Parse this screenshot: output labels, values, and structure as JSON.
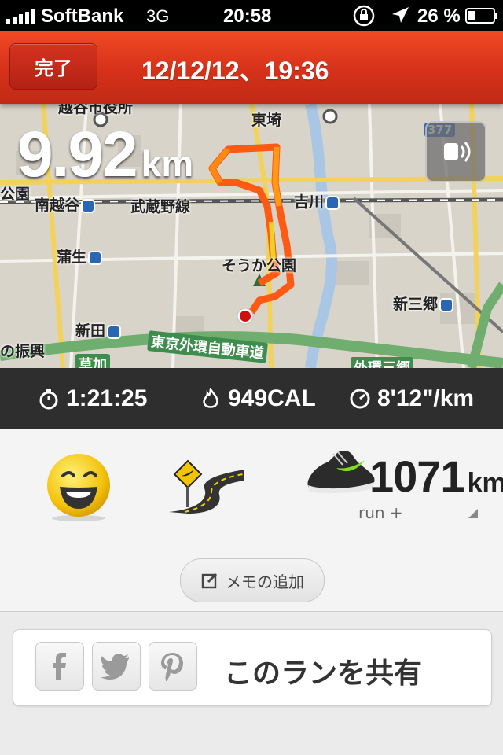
{
  "status_bar": {
    "carrier": "SoftBank",
    "network": "3G",
    "time": "20:58",
    "battery": "26 %",
    "icons": [
      "signal-icon",
      "rotation-lock-icon",
      "location-arrow-icon",
      "battery-icon"
    ]
  },
  "nav": {
    "done_label": "完了",
    "title": "12/12/12、19:36"
  },
  "map": {
    "labels": {
      "koshigaya_city_hall": "越谷市役所",
      "minami_koshigaya": "南越谷",
      "musashino_line": "武蔵野線",
      "yoshikawa": "吉川",
      "gamo": "蒲生",
      "soka_park": "そうか公園",
      "shinmisato": "新三郷",
      "shinden": "新田",
      "tokyo_gaikan": "東京外環自動車道",
      "soka": "草加",
      "gaikan_misato": "外環三郷",
      "park_left": "公園",
      "shinko": "の振興",
      "route377": "377",
      "tobu": "東埼"
    },
    "route_colors": {
      "fast": "#ff9a12",
      "slow": "#f0d024",
      "mid": "#ff6a14"
    }
  },
  "run": {
    "distance": "9.92",
    "distance_unit": "km",
    "duration": "1:21:25",
    "calories": "949CAL",
    "pace": "8'12\"/km"
  },
  "summary": {
    "mood_icon": "smiley-icon",
    "terrain_icon": "road-icon",
    "shoe_distance": "1071",
    "shoe_distance_unit": "km",
    "shoe_name": "run +",
    "memo_label": "メモの追加"
  },
  "share": {
    "label": "このランを共有",
    "buttons": [
      "facebook-icon",
      "twitter-icon",
      "pinterest-icon"
    ]
  },
  "colors": {
    "nav_red": "#d5311a",
    "stats_bg": "#2e2e2e",
    "panel_bg": "#f4f4f4"
  }
}
